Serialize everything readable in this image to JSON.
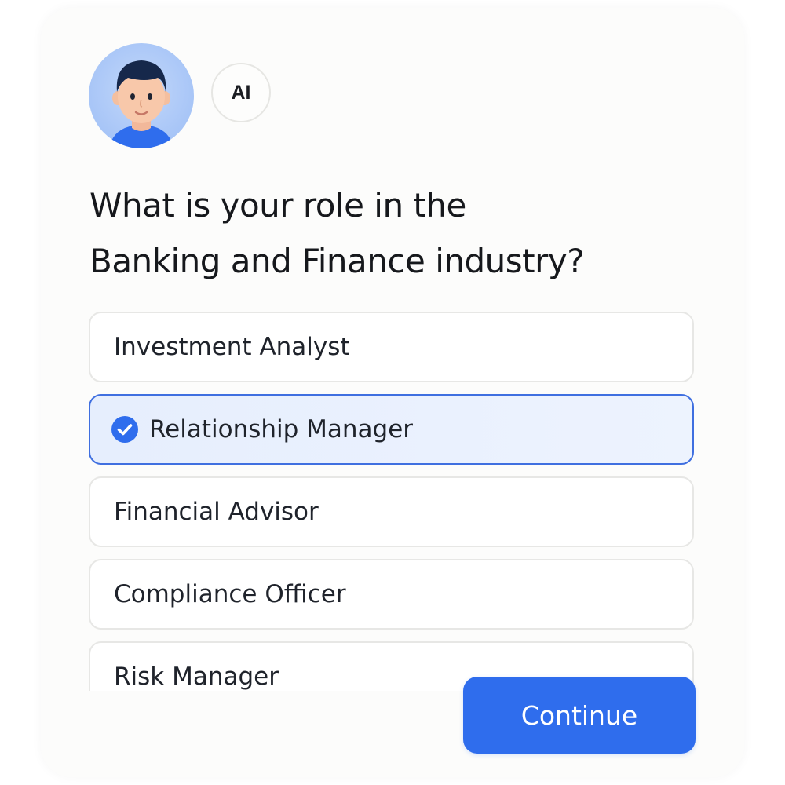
{
  "header": {
    "avatar_icon": "user-avatar-icon",
    "ai_badge_label": "AI"
  },
  "question": {
    "line1": "What is your role in the",
    "line2": "Banking and Finance industry?"
  },
  "options": [
    {
      "label": "Investment Analyst",
      "selected": false
    },
    {
      "label": "Relationship Manager",
      "selected": true
    },
    {
      "label": "Financial Advisor",
      "selected": false
    },
    {
      "label": "Compliance Officer",
      "selected": false
    },
    {
      "label": "Risk Manager",
      "selected": false
    }
  ],
  "selected_icon": "check-circle-icon",
  "continue_label": "Continue",
  "colors": {
    "accent": "#2f6ded",
    "selected_border": "#3f6fe0",
    "selected_background": "#e9f0fd",
    "text": "#16181c"
  }
}
